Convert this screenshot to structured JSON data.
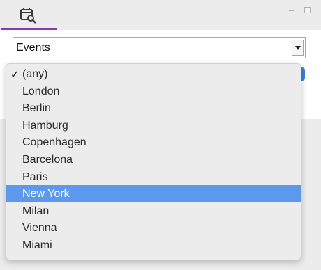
{
  "header": {
    "tab_icon": "calendar-search-icon",
    "accent_color": "#8b36b8"
  },
  "window_controls": [
    "minimize-icon",
    "maximize-icon"
  ],
  "type_select": {
    "value": "Events"
  },
  "city_dropdown": {
    "checked_option": "(any)",
    "highlighted_option": "New York",
    "highlight_color": "#5c98ec",
    "options": [
      "(any)",
      "London",
      "Berlin",
      "Hamburg",
      "Copenhagen",
      "Barcelona",
      "Paris",
      "New York",
      "Milan",
      "Vienna",
      "Miami"
    ],
    "check_mark": "✓"
  }
}
